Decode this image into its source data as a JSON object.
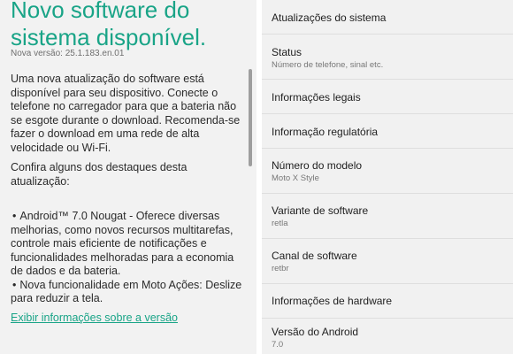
{
  "update_screen": {
    "title": "Novo software do sistema disponível.",
    "version": "Nova versão: 25.1.183.en.01",
    "paragraph1": "Uma nova atualização do software está disponível para seu dispositivo. Conecte o telefone no carregador para que a bateria não se esgote durante o download. Recomenda-se fazer o download em uma rede de alta velocidade ou Wi-Fi.",
    "paragraph2": "Confira alguns dos destaques desta atualização:",
    "bullets": [
      "Android™ 7.0 Nougat - Oferece diversas melhorias, como novos recursos multitarefas, controle mais eficiente de notificações e funcionalidades melhoradas para a economia de dados e da bateria.",
      "Nova funcionalidade em Moto Ações: Deslize para reduzir a tela."
    ],
    "bullet_symbol": "•",
    "link": "Exibir informações sobre a versão"
  },
  "about_phone": {
    "items": [
      {
        "label": "Atualizações do sistema",
        "sub": ""
      },
      {
        "label": "Status",
        "sub": "Número de telefone, sinal etc."
      },
      {
        "label": "Informações legais",
        "sub": ""
      },
      {
        "label": "Informação regulatória",
        "sub": ""
      },
      {
        "label": "Número do modelo",
        "sub": "Moto X Style"
      },
      {
        "label": "Variante de software",
        "sub": "retla"
      },
      {
        "label": "Canal de software",
        "sub": "retbr"
      },
      {
        "label": "Informações de hardware",
        "sub": ""
      },
      {
        "label": "Versão do Android",
        "sub": "7.0"
      }
    ]
  },
  "colors": {
    "accent": "#19a487",
    "left_background": "#f2f2f2",
    "right_background": "#f1f1f1",
    "divider": "#dedede"
  }
}
